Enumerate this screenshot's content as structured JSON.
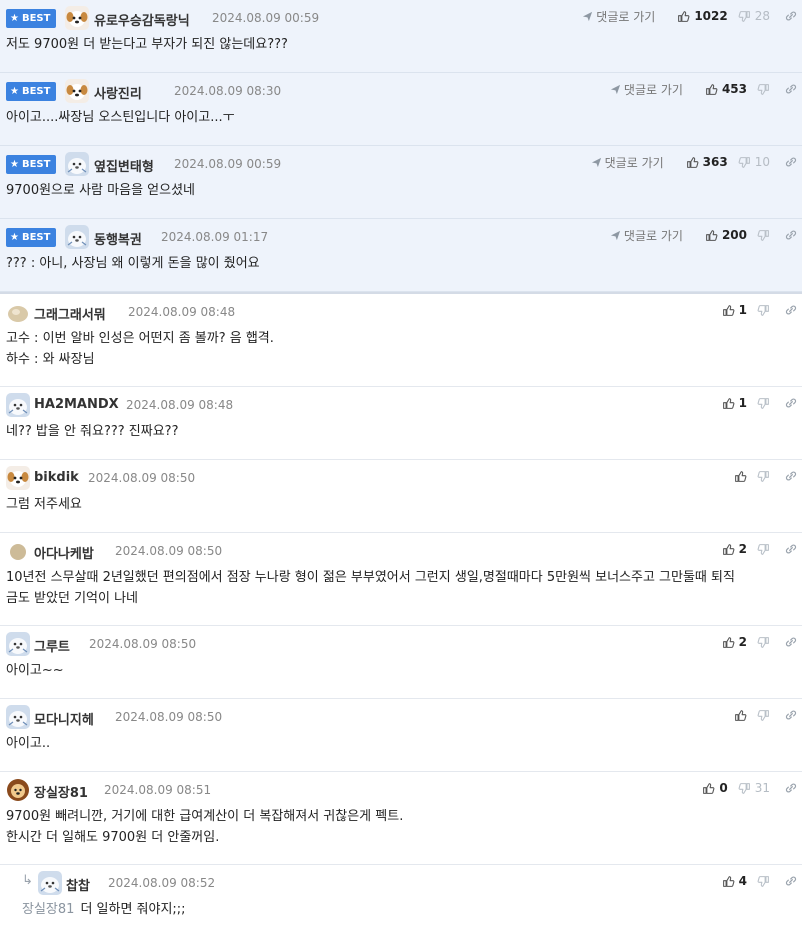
{
  "best_badge_label": "BEST",
  "reply_link_label": "댓글로 가기",
  "best_comments": [
    {
      "nick": "유로우승감독랑닉",
      "date": "2024.08.09 00:59",
      "up": "1022",
      "down": "28",
      "lines": [
        "저도 9700원 더 받는다고 부자가 되진 않는데요???"
      ]
    },
    {
      "nick": "사랑진리",
      "date": "2024.08.09 08:30",
      "up": "453",
      "down": "",
      "lines": [
        "아이고....싸장님 오스틴입니다 아이고...ㅜ"
      ]
    },
    {
      "nick": "옆집변태형",
      "date": "2024.08.09 00:59",
      "up": "363",
      "down": "10",
      "lines": [
        "9700원으로 사람 마음을 얻으셨네"
      ]
    },
    {
      "nick": "동행복권",
      "date": "2024.08.09 01:17",
      "up": "200",
      "down": "",
      "lines": [
        "??? : 아니, 사장님 왜 이렇게 돈을 많이 줬어요"
      ]
    }
  ],
  "comments": [
    {
      "nick": "그래그래서뭐",
      "date": "2024.08.09 08:48",
      "up": "1",
      "down": "",
      "lines": [
        "고수 : 이번 알바 인성은 어떤지 좀 볼까? 음 햅격.",
        "하수 : 와 싸장님"
      ]
    },
    {
      "nick": "HA2MANDX",
      "date": "2024.08.09 08:48",
      "up": "1",
      "down": "",
      "lines": [
        "네?? 밥을 안 줘요??? 진짜요??"
      ]
    },
    {
      "nick": "bikdik",
      "date": "2024.08.09 08:50",
      "up": "",
      "down": "",
      "lines": [
        "그럼 저주세요"
      ]
    },
    {
      "nick": "아다나케밥",
      "date": "2024.08.09 08:50",
      "up": "2",
      "down": "",
      "lines": [
        "10년전 스무살때 2년일했던 편의점에서 점장 누나랑 형이 젊은 부부였어서 그런지 생일,명절때마다 5만원씩 보너스주고 그만둘때 퇴직",
        "금도 받았던 기억이 나네"
      ]
    },
    {
      "nick": "그루트",
      "date": "2024.08.09 08:50",
      "up": "2",
      "down": "",
      "lines": [
        "아이고~~"
      ]
    },
    {
      "nick": "모다니지헤",
      "date": "2024.08.09 08:50",
      "up": "",
      "down": "",
      "lines": [
        "아이고.."
      ]
    },
    {
      "nick": "장실장81",
      "date": "2024.08.09 08:51",
      "up": "0",
      "down": "31",
      "lines": [
        "9700원 빼려니깐, 거기에 대한 급여계산이 더 복잡해져서 귀찮은게 펙트.",
        "한시간 더 일해도 9700원 더 안줄꺼임."
      ]
    }
  ],
  "reply": {
    "nick": "찹찹",
    "date": "2024.08.09 08:52",
    "up": "4",
    "down": "",
    "mention": "장실장81",
    "text": "더 일하면 줘야지;;;"
  },
  "colors": {
    "best_bg": "#eef3fb",
    "badge": "#3b82e0"
  }
}
